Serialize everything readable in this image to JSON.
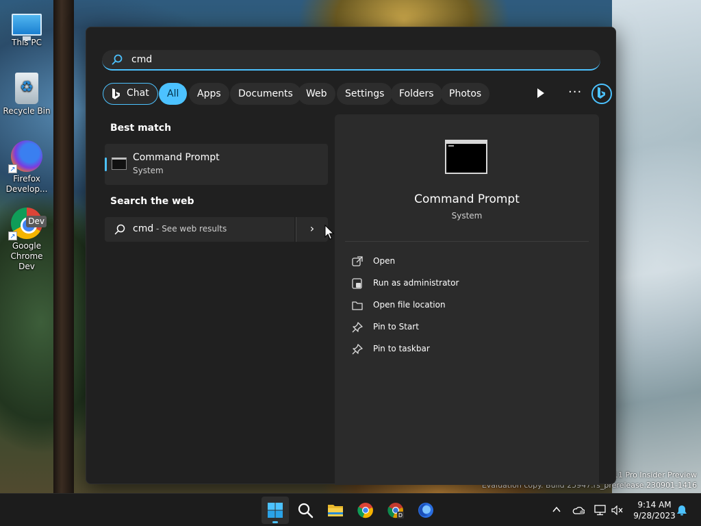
{
  "desktop": {
    "icons": [
      {
        "label": "This PC",
        "icon": "monitor-icon"
      },
      {
        "label": "Recycle Bin",
        "icon": "recycle-bin-icon"
      },
      {
        "label": "Firefox Develop...",
        "icon": "firefox-dev-icon"
      },
      {
        "label": "Google Chrome Dev",
        "icon": "chrome-dev-icon",
        "badge": "Dev"
      }
    ]
  },
  "search": {
    "query": "cmd"
  },
  "filters": {
    "chat": "Chat",
    "all": "All",
    "apps": "Apps",
    "documents": "Documents",
    "web": "Web",
    "settings": "Settings",
    "folders": "Folders",
    "photos": "Photos",
    "more": "···",
    "active": "All"
  },
  "results": {
    "best_match_heading": "Best match",
    "best_match": {
      "title": "Command Prompt",
      "subtitle": "System",
      "icon": "command-prompt-icon"
    },
    "search_web_heading": "Search the web",
    "web_query": "cmd",
    "web_suffix": " - See web results"
  },
  "detail": {
    "title": "Command Prompt",
    "subtitle": "System",
    "actions": [
      {
        "label": "Open",
        "icon": "open-external-icon"
      },
      {
        "label": "Run as administrator",
        "icon": "shield-admin-icon"
      },
      {
        "label": "Open file location",
        "icon": "folder-icon"
      },
      {
        "label": "Pin to Start",
        "icon": "pin-icon"
      },
      {
        "label": "Pin to taskbar",
        "icon": "pin-icon"
      }
    ]
  },
  "watermark": {
    "line1": "11 Pro Insider Preview",
    "line2": "Evaluation copy. Build 25947.rs_prerelease.230901-1416"
  },
  "taskbar": {
    "apps": [
      "start-icon",
      "search-icon",
      "file-explorer-icon",
      "chrome-icon",
      "chrome-dev-icon",
      "firefox-dev-icon"
    ],
    "time": "9:14 AM",
    "date": "9/28/2023"
  },
  "colors": {
    "accent": "#4cc2ff",
    "flyout_bg": "#202020",
    "card_bg": "#2b2b2b",
    "taskbar_bg": "#1c1c1c"
  }
}
